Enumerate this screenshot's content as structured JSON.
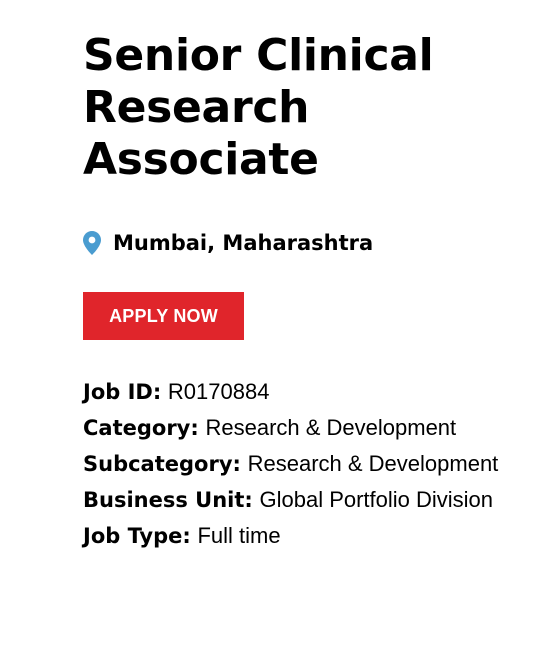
{
  "job": {
    "title": "Senior Clinical Research Associate",
    "location": "Mumbai, Maharashtra",
    "apply_label": "APPLY NOW"
  },
  "details": {
    "job_id": {
      "label": "Job ID:",
      "value": "R0170884"
    },
    "category": {
      "label": "Category:",
      "value": "Research & Development"
    },
    "subcategory": {
      "label": "Subcategory:",
      "value": "Research & Development"
    },
    "business_unit": {
      "label": "Business Unit:",
      "value": "Global Portfolio Division"
    },
    "job_type": {
      "label": "Job Type:",
      "value": "Full time"
    }
  },
  "colors": {
    "accent": "#e0252b",
    "pin": "#4a9cd0"
  },
  "icons": {
    "location": "map-pin-icon"
  }
}
